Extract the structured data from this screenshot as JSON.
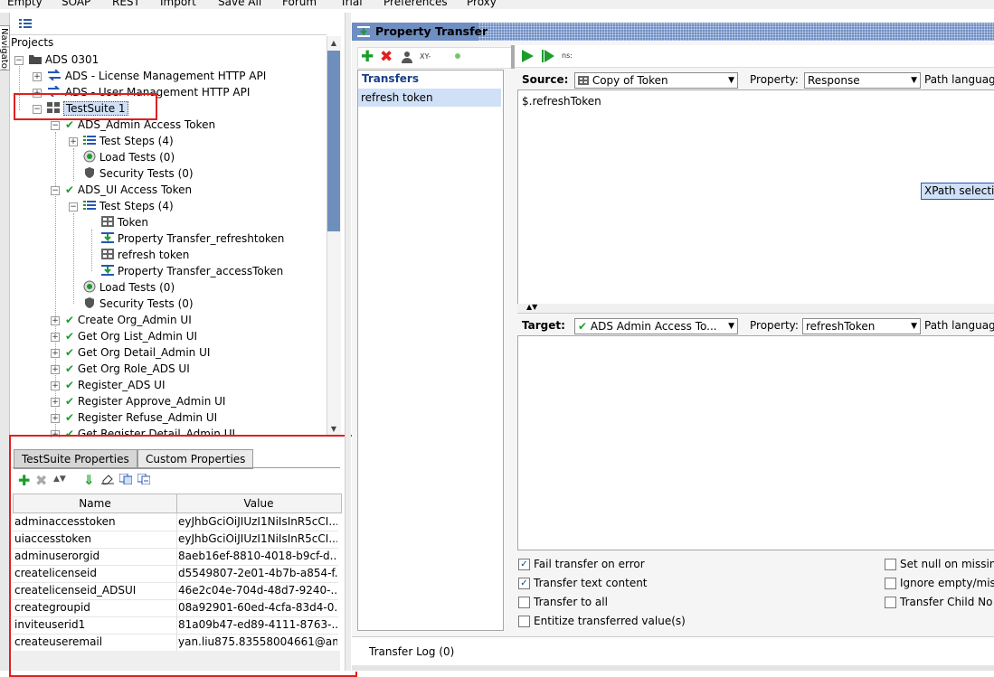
{
  "menu": [
    "Empty",
    "SOAP",
    "REST",
    "Import",
    "Save All",
    "Forum",
    "Trial",
    "Preferences",
    "Proxy"
  ],
  "nav": {
    "tab_label": "Navigator",
    "projects_label": "Projects"
  },
  "tree": {
    "project": "ADS 0301",
    "apis": [
      "ADS - License Management HTTP API",
      "ADS - User Management HTTP API"
    ],
    "suite": "TestSuite 1",
    "case1": {
      "name": "ADS_Admin Access Token",
      "steps": "Test Steps (4)",
      "load": "Load Tests (0)",
      "security": "Security Tests (0)"
    },
    "case2": {
      "name": "ADS_UI Access Token",
      "steps": "Test Steps (4)",
      "step_items": [
        "Token",
        "Property Transfer_refreshtoken",
        "refresh token",
        "Property Transfer_accessToken"
      ],
      "load": "Load Tests (0)",
      "security": "Security Tests (0)"
    },
    "cases": [
      "Create Org_Admin UI",
      "Get Org List_Admin UI",
      "Get Org Detail_Admin UI",
      "Get Org Role_ADS UI",
      "Register_ADS UI",
      "Register Approve_Admin UI",
      "Register Refuse_Admin UI",
      "Get Register Detail_Admin UI"
    ]
  },
  "props": {
    "tab_active": "TestSuite Properties",
    "tab_other": "Custom Properties",
    "col_name": "Name",
    "col_value": "Value",
    "rows": [
      {
        "name": "adminaccesstoken",
        "value": "eyJhbGciOiJIUzI1NiIsInR5cCI..."
      },
      {
        "name": "uiaccesstoken",
        "value": "eyJhbGciOiJIUzI1NiIsInR5cCI..."
      },
      {
        "name": "adminuserorgid",
        "value": "8aeb16ef-8810-4018-b9cf-d..."
      },
      {
        "name": "createlicenseid",
        "value": "d5549807-2e01-4b7b-a854-f..."
      },
      {
        "name": "createlicenseid_ADSUI",
        "value": "46e2c04e-704d-48d7-9240-..."
      },
      {
        "name": "creategroupid",
        "value": "08a92901-60ed-4cfa-83d4-0..."
      },
      {
        "name": "inviteuserid1",
        "value": "81a09b47-ed89-4111-8763-..."
      },
      {
        "name": "createuseremail",
        "value": "yan.liu875.83558004661@am..."
      }
    ]
  },
  "transfer": {
    "title": "Property Transfer",
    "xy_label": "XY-",
    "ns_label": "ns:",
    "transfers_label": "Transfers",
    "transfer_item": "refresh token",
    "source_label": "Source:",
    "source_value": "Copy of Token",
    "property_label": "Property:",
    "source_property": "Response",
    "path_language": "Path language",
    "source_expression": "$.refreshToken",
    "xpath_tooltip": "XPath selectio",
    "target_label": "Target:",
    "target_value": "ADS Admin Access To...",
    "target_property": "refreshToken",
    "options_left": [
      {
        "label": "Fail transfer on error",
        "checked": "✓"
      },
      {
        "label": "Transfer text content",
        "checked": "✓"
      },
      {
        "label": "Transfer to all",
        "checked": ""
      },
      {
        "label": "Entitize transferred value(s)",
        "checked": ""
      }
    ],
    "options_right": [
      "Set null on missing",
      "Ignore empty/mis",
      "Transfer Child No"
    ],
    "log_tab": "Transfer Log (0)"
  },
  "colors": {
    "header_blue": "#6f8ec2",
    "selection": "#cfe0f7",
    "accent_red": "#e02020",
    "check_green": "#1b9d2b"
  }
}
